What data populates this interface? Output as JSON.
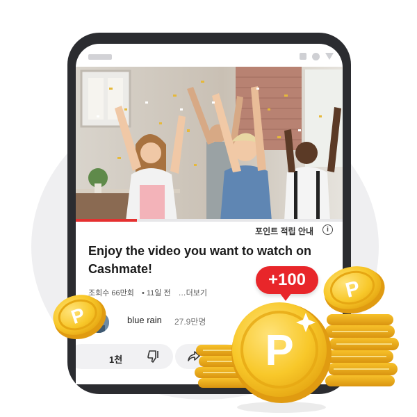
{
  "player": {
    "progress_fraction": 0.23,
    "points_guide_label": "포인트 적립 안내",
    "info_icon_glyph": "i"
  },
  "video": {
    "title": "Enjoy the video you want to watch on Cashmate!",
    "views": "조회수 66만회",
    "age": "• 11일 전",
    "more": "…더보기"
  },
  "channel": {
    "name": "blue rain",
    "subscribers": "27.9만명"
  },
  "actions": {
    "like_count": "1천",
    "dislike_icon": "thumbs-down-icon",
    "share_icon": "share-icon"
  },
  "reward": {
    "badge_text": "+100",
    "coin_letter": "P"
  },
  "colors": {
    "accent_red": "#e8262a",
    "coin_gold": "#f5c21b",
    "phone_frame": "#2b2c30"
  }
}
